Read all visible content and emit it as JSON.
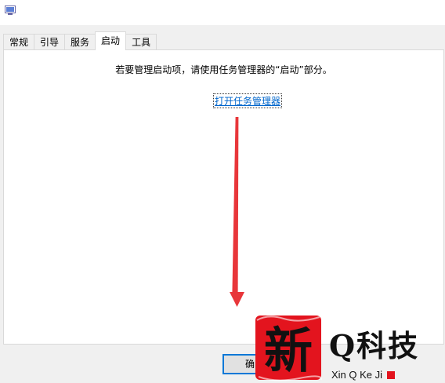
{
  "tabs": [
    {
      "label": "常规"
    },
    {
      "label": "引导"
    },
    {
      "label": "服务"
    },
    {
      "label": "启动",
      "active": true
    },
    {
      "label": "工具"
    }
  ],
  "startup": {
    "message": "若要管理启动项，请使用任务管理器的“启动”部分。",
    "link_label": "打开任务管理器"
  },
  "buttons": {
    "ok_label": "确"
  },
  "watermark": {
    "seal_char": "新",
    "title": "Q科技",
    "subtitle": "Xin Q Ke Ji"
  },
  "colors": {
    "link": "#0066cc",
    "arrow": "#e8363a",
    "focus_border": "#0078d7",
    "watermark_red": "#e3141e"
  },
  "icons": [
    "app-icon"
  ]
}
